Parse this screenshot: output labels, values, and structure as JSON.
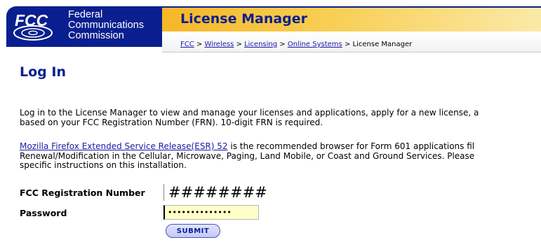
{
  "header": {
    "logo": {
      "abbr": "FCC",
      "line1": "Federal",
      "line2": "Communications",
      "line3": "Commission"
    },
    "title": "License Manager",
    "breadcrumb": {
      "items": [
        "FCC",
        "Wireless",
        "Licensing",
        "Online Systems"
      ],
      "separator": " > ",
      "current": "License Manager"
    }
  },
  "main": {
    "page_title": "Log In",
    "intro_line1": "Log in to the License Manager to view and manage your licenses and applications, apply for a new license, a",
    "intro_line2": "based on your FCC Registration Number (FRN). 10-digit FRN is required.",
    "browser_link": "Mozilla Firefox Extended Service Release(ESR) 52",
    "browser_line1_rest": " is the recommended browser for Form 601 applications fil",
    "browser_line2": "Renewal/Modification in the Cellular, Microwave, Paging, Land Mobile, or Coast and Ground Services. Please",
    "browser_line3": "specific instructions on this installation."
  },
  "form": {
    "frn_label": "FCC Registration Number",
    "frn_value": "########",
    "password_label": "Password",
    "password_value": "••••••••••••••",
    "submit_label": "SUBMIT"
  },
  "colors": {
    "fcc_blue": "#0a1f8f",
    "title_bar_gold": "#f6b728",
    "link_blue": "#1a1aa6",
    "password_bg": "#fffdc8"
  }
}
